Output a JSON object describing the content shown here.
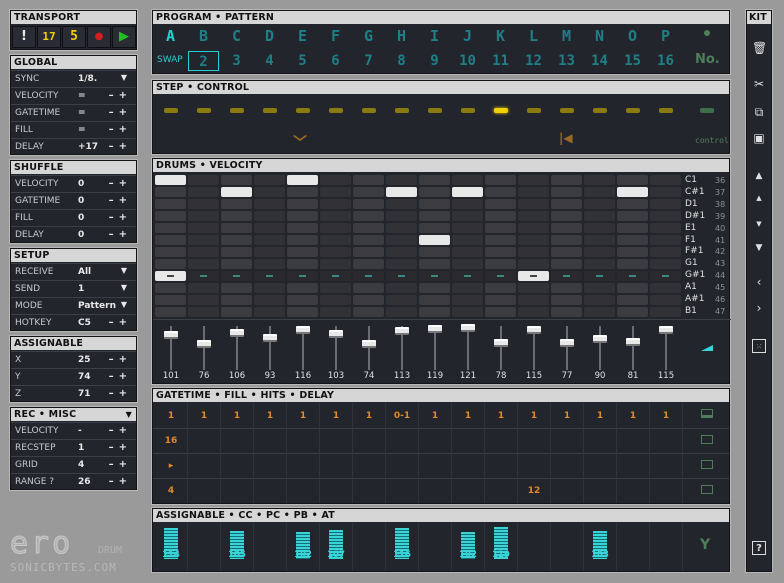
{
  "transport": {
    "title": "TRANSPORT",
    "buttons": [
      "!",
      "17",
      "5",
      "●",
      "▶"
    ]
  },
  "global": {
    "title": "GLOBAL",
    "rows": [
      {
        "label": "SYNC",
        "value": "1/8."
      },
      {
        "label": "VELOCITY",
        "value": "="
      },
      {
        "label": "GATETIME",
        "value": "="
      },
      {
        "label": "FILL",
        "value": "="
      },
      {
        "label": "DELAY",
        "value": "+17"
      }
    ]
  },
  "shuffle": {
    "title": "SHUFFLE",
    "rows": [
      {
        "label": "VELOCITY",
        "value": "0"
      },
      {
        "label": "GATETIME",
        "value": "0"
      },
      {
        "label": "FILL",
        "value": "0"
      },
      {
        "label": "DELAY",
        "value": "0"
      }
    ]
  },
  "setup": {
    "title": "SETUP",
    "rows": [
      {
        "label": "RECEIVE",
        "value": "All"
      },
      {
        "label": "SEND",
        "value": "1"
      },
      {
        "label": "MODE",
        "value": "Pattern"
      },
      {
        "label": "HOTKEY",
        "value": "C5"
      }
    ]
  },
  "assignable_left": {
    "title": "ASSIGNABLE",
    "rows": [
      {
        "label": "X",
        "value": "25"
      },
      {
        "label": "Y",
        "value": "74"
      },
      {
        "label": "Z",
        "value": "71"
      }
    ]
  },
  "recmisc": {
    "title": "REC • MISC",
    "rows": [
      {
        "label": "VELOCITY",
        "value": "-"
      },
      {
        "label": "RECSTEP",
        "value": "1"
      },
      {
        "label": "GRID",
        "value": "4"
      },
      {
        "label": "RANGE ?",
        "value": "26"
      }
    ]
  },
  "program": {
    "title": "PROGRAM • PATTERN",
    "programs": [
      "A",
      "B",
      "C",
      "D",
      "E",
      "F",
      "G",
      "H",
      "I",
      "J",
      "K",
      "L",
      "M",
      "N",
      "O",
      "P"
    ],
    "swap_label": "SWAP",
    "patterns": [
      "1",
      "2",
      "3",
      "4",
      "5",
      "6",
      "7",
      "8",
      "9",
      "10",
      "11",
      "12",
      "13",
      "14",
      "15",
      "16"
    ],
    "no_label": "No.",
    "active_program_index": 0,
    "active_pattern_index": 1
  },
  "step": {
    "title": "STEP • CONTROL",
    "active_step_index": 10,
    "control_label": "control"
  },
  "drums": {
    "title": "DRUMS • VELOCITY",
    "notes": [
      {
        "name": "C1",
        "num": "36"
      },
      {
        "name": "C#1",
        "num": "37"
      },
      {
        "name": "D1",
        "num": "38"
      },
      {
        "name": "D#1",
        "num": "39"
      },
      {
        "name": "E1",
        "num": "40"
      },
      {
        "name": "F1",
        "num": "41"
      },
      {
        "name": "F#1",
        "num": "42"
      },
      {
        "name": "G1",
        "num": "43"
      },
      {
        "name": "G#1",
        "num": "44"
      },
      {
        "name": "A1",
        "num": "45"
      },
      {
        "name": "A#1",
        "num": "46"
      },
      {
        "name": "B1",
        "num": "47"
      }
    ],
    "active_notes": [
      [
        0,
        0
      ],
      [
        4,
        0
      ],
      [
        2,
        1
      ],
      [
        7,
        1
      ],
      [
        9,
        1
      ],
      [
        14,
        1
      ],
      [
        8,
        5
      ],
      [
        0,
        8
      ],
      [
        11,
        8
      ]
    ],
    "velocities": [
      101,
      76,
      106,
      93,
      116,
      103,
      74,
      113,
      119,
      121,
      78,
      115,
      77,
      90,
      81,
      115
    ]
  },
  "gatetime": {
    "title": "GATETIME • FILL • HITS • DELAY",
    "gate_row": [
      "1",
      "1",
      "1",
      "1",
      "1",
      "1",
      "1",
      "0-1",
      "1",
      "1",
      "1",
      "1",
      "1",
      "1",
      "1",
      "1"
    ],
    "fill_row": [
      "16",
      "",
      "",
      "",
      "",
      "",
      "",
      "",
      "",
      "",
      "",
      "",
      "",
      "",
      "",
      ""
    ],
    "hits_row": [
      "▸",
      "",
      "",
      "",
      "",
      "",
      "",
      "",
      "",
      "",
      "",
      "",
      "",
      "",
      "",
      ""
    ],
    "delay_row": [
      "4",
      "",
      "",
      "",
      "",
      "",
      "",
      "",
      "",
      "",
      "",
      "12",
      "",
      "",
      "",
      ""
    ]
  },
  "assignable_cc": {
    "title": "ASSIGNABLE • CC • PC • PB • AT",
    "values": [
      "114",
      "",
      "105",
      "",
      "102",
      "107",
      "",
      "116",
      "",
      "102",
      "119",
      "",
      "",
      "103",
      "",
      ""
    ],
    "axis_label": "Y"
  },
  "kit": {
    "title": "KIT",
    "help_label": "?"
  },
  "logo": {
    "name": "ero",
    "sub": "DRUM",
    "brand": "SONICBYTES.COM"
  },
  "colors": {
    "accent": "#24d0d0",
    "orange": "#e08a2a",
    "yellow": "#f0d000",
    "panel": "#23252d"
  }
}
